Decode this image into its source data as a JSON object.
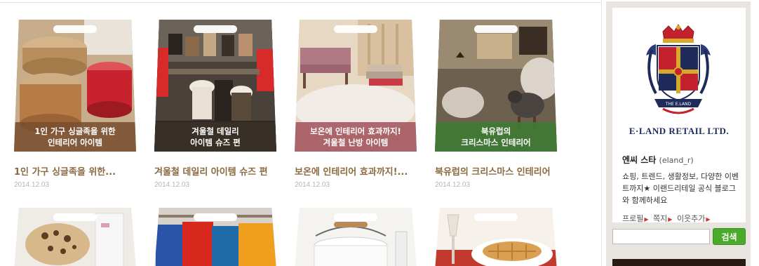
{
  "posts": [
    {
      "cap1": "1인 가구 싱글족을 위한",
      "cap2": "인테리어 아이템",
      "title": "1인 가구 싱글족을 위한...",
      "date": "2014.12.03"
    },
    {
      "cap1": "겨울철 데일리",
      "cap2": "아이템 슈즈 편",
      "title": "겨울철 데일리 아이템 슈즈 편",
      "date": "2014.12.03"
    },
    {
      "cap1": "보온에 인테리어 효과까지!",
      "cap2": "겨울철 난방 아이템",
      "title": "보온에 인테리어 효과까지!...",
      "date": "2014.12.03"
    },
    {
      "cap1": "북유럽의",
      "cap2": "크리스마스 인테리어",
      "title": "북유럽의 크리스마스 인테리어",
      "date": "2014.12.03"
    }
  ],
  "sidebar": {
    "brand": "E·LAND RETAIL LTD.",
    "crest_text": "THE E.LAND",
    "blog_name": "엔씨 스타",
    "blog_id": "(eland_r)",
    "description": "쇼핑, 트렌드, 생활정보, 다양한 이벤트까지★ 이랜드리테일 공식 블로그와 함께하세요",
    "links": [
      "프로필",
      "쪽지",
      "이웃추가"
    ],
    "search_button": "검색",
    "search_placeholder": ""
  },
  "colors": {
    "accent_green": "#4aab2a",
    "title_brown": "#8a6a40",
    "caption_brown": "#7a5030",
    "caption_dark": "#3a3028",
    "caption_rose": "#a0505a",
    "caption_green": "#3c7a32"
  }
}
